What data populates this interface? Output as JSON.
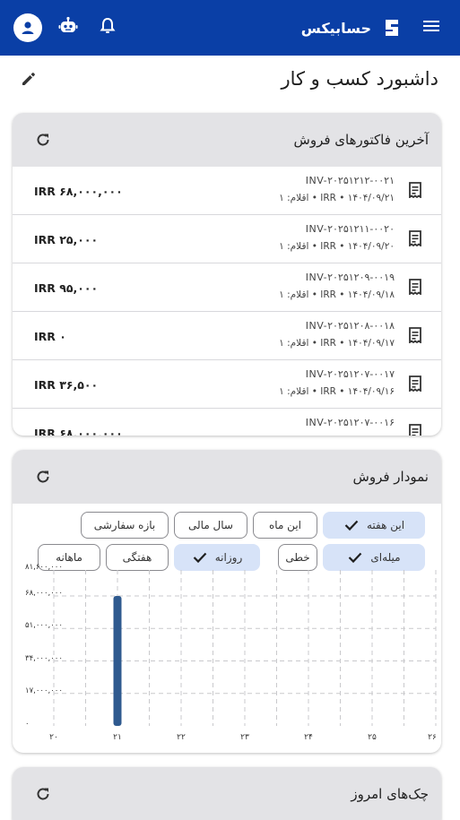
{
  "appbar": {
    "brand_name": "حسابیکس",
    "icons": [
      "account-circle-icon",
      "robot-icon",
      "bell-icon",
      "hamburger-menu-icon"
    ],
    "color": "#0a3fa6"
  },
  "page": {
    "title": "داشبورد کسب و کار"
  },
  "invoices_card": {
    "title": "آخرین فاکتورهای فروش",
    "rows": [
      {
        "number": "INV-۲۰۲۵۱۲۱۲-۰۰۲۱",
        "meta": "IRR • ۱۴۰۴/۰۹/۲۱ • اقلام: ۱",
        "amount": "IRR ۶۸,۰۰۰,۰۰۰"
      },
      {
        "number": "INV-۲۰۲۵۱۲۱۱-۰۰۲۰",
        "meta": "IRR • ۱۴۰۴/۰۹/۲۰ • اقلام: ۱",
        "amount": "IRR ۲۵,۰۰۰"
      },
      {
        "number": "INV-۲۰۲۵۱۲۰۹-۰۰۱۹",
        "meta": "IRR • ۱۴۰۴/۰۹/۱۸ • اقلام: ۱",
        "amount": "IRR ۹۵,۰۰۰"
      },
      {
        "number": "INV-۲۰۲۵۱۲۰۸-۰۰۱۸",
        "meta": "IRR • ۱۴۰۴/۰۹/۱۷ • اقلام: ۱",
        "amount": "IRR ۰"
      },
      {
        "number": "INV-۲۰۲۵۱۲۰۷-۰۰۱۷",
        "meta": "IRR • ۱۴۰۴/۰۹/۱۶ • اقلام: ۱",
        "amount": "IRR ۳۶,۵۰۰"
      },
      {
        "number": "INV-۲۰۲۵۱۲۰۷-۰۰۱۶",
        "meta": "",
        "amount": "IRR ۶۸,۰۰۰,۰۰۰"
      }
    ]
  },
  "sales_chart_card": {
    "title": "نمودار فروش",
    "period_chips": [
      {
        "label": "این هفته",
        "selected": true
      },
      {
        "label": "این ماه",
        "selected": false
      },
      {
        "label": "سال مالی",
        "selected": false
      },
      {
        "label": "بازه سفارشی",
        "selected": false
      }
    ],
    "type_chips": [
      {
        "label": "میله‌ای",
        "selected": true
      },
      {
        "label": "خطی",
        "selected": false
      }
    ],
    "granularity_chips": [
      {
        "label": "روزانه",
        "selected": true
      },
      {
        "label": "هفتگی",
        "selected": false
      },
      {
        "label": "ماهانه",
        "selected": false
      }
    ]
  },
  "chart_data": {
    "type": "bar",
    "x": [
      20,
      21,
      22,
      23,
      24,
      25,
      26
    ],
    "x_tick_labels": [
      "۲۰",
      "۲۱",
      "۲۲",
      "۲۳",
      "۲۴",
      "۲۵",
      "۲۶"
    ],
    "values": [
      0,
      68000000,
      0,
      0,
      0,
      0,
      0
    ],
    "y_tick_labels": [
      "۸۱,۶۰۰,۰۰۰",
      "۶۸,۰۰۰,۰۰۰",
      "۵۱,۰۰۰,۰۰۰",
      "۳۴,۰۰۰,۰۰۰",
      "۱۷,۰۰۰,۰۰۰",
      "۰"
    ],
    "ylim": [
      0,
      81600000
    ],
    "xlim": [
      20,
      26
    ],
    "grid": true,
    "bar_color": "#2f5a8f"
  },
  "cheques_card": {
    "title": "چک‌های امروز"
  }
}
